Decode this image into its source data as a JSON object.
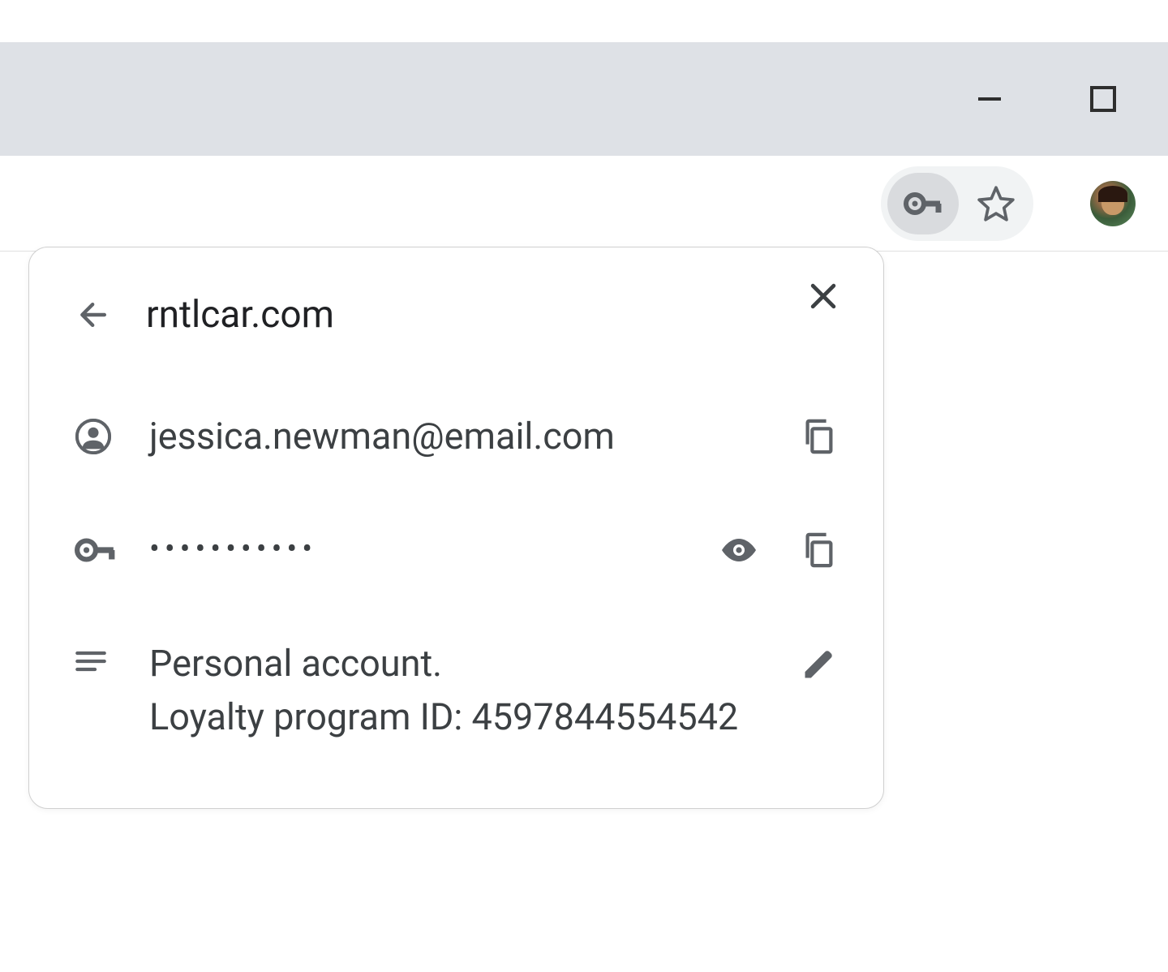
{
  "popup": {
    "site": "rntlcar.com",
    "username": "jessica.newman@email.com",
    "password_masked": "•••••••••••",
    "note_line1": "Personal account.",
    "note_line2": "Loyalty program ID: 4597844554542"
  }
}
